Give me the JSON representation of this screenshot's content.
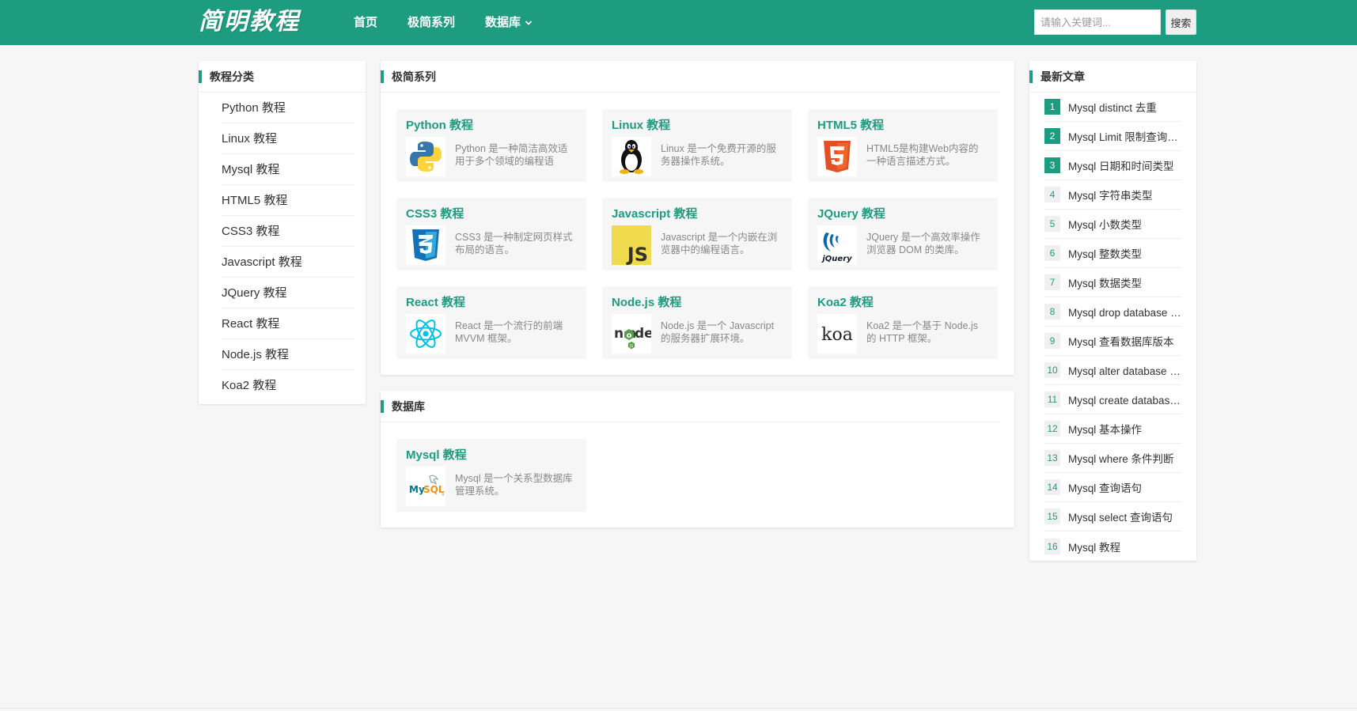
{
  "header": {
    "logo": "简明教程",
    "nav": [
      {
        "label": "首页"
      },
      {
        "label": "极简系列"
      },
      {
        "label": "数据库",
        "has_dropdown": true
      }
    ],
    "search": {
      "placeholder": "请输入关键词...",
      "value": "",
      "button_label": "搜索"
    }
  },
  "sidebar_left": {
    "title": "教程分类",
    "items": [
      {
        "label": "Python 教程"
      },
      {
        "label": "Linux 教程"
      },
      {
        "label": "Mysql 教程"
      },
      {
        "label": "HTML5 教程"
      },
      {
        "label": "CSS3 教程"
      },
      {
        "label": "Javascript 教程"
      },
      {
        "label": "JQuery 教程"
      },
      {
        "label": "React 教程"
      },
      {
        "label": "Node.js 教程"
      },
      {
        "label": "Koa2 教程"
      }
    ]
  },
  "sections": [
    {
      "title": "极简系列",
      "tutorials": [
        {
          "name": "Python 教程",
          "desc": "Python 是一种简洁高效适用于多个领域的编程语",
          "icon": "python-icon"
        },
        {
          "name": "Linux 教程",
          "desc": "Linux 是一个免费开源的服务器操作系统。",
          "icon": "linux-tux-icon"
        },
        {
          "name": "HTML5 教程",
          "desc": "HTML5是构建Web内容的一种语言描述方式。",
          "icon": "html5-icon"
        },
        {
          "name": "CSS3 教程",
          "desc": "CSS3 是一种制定网页样式布局的语言。",
          "icon": "css3-icon"
        },
        {
          "name": "Javascript 教程",
          "desc": "Javascript 是一个内嵌在浏览器中的编程语言。",
          "icon": "javascript-icon"
        },
        {
          "name": "JQuery 教程",
          "desc": "JQuery 是一个高效率操作浏览器 DOM 的类库。",
          "icon": "jquery-icon"
        },
        {
          "name": "React 教程",
          "desc": "React 是一个流行的前端 MVVM 框架。",
          "icon": "react-icon"
        },
        {
          "name": "Node.js 教程",
          "desc": "Node.js 是一个 Javascript 的服务器扩展环境。",
          "icon": "nodejs-icon"
        },
        {
          "name": "Koa2 教程",
          "desc": "Koa2 是一个基于 Node.js 的 HTTP 框架。",
          "icon": "koa-icon"
        }
      ]
    },
    {
      "title": "数据库",
      "tutorials": [
        {
          "name": "Mysql 教程",
          "desc": "Mysql 是一个关系型数据库管理系统。",
          "icon": "mysql-icon"
        }
      ]
    }
  ],
  "sidebar_right": {
    "title": "最新文章",
    "articles": [
      {
        "num": "1",
        "title": "Mysql distinct 去重"
      },
      {
        "num": "2",
        "title": "Mysql Limit 限制查询记录数"
      },
      {
        "num": "3",
        "title": "Mysql 日期和时间类型"
      },
      {
        "num": "4",
        "title": "Mysql 字符串类型"
      },
      {
        "num": "5",
        "title": "Mysql 小数类型"
      },
      {
        "num": "6",
        "title": "Mysql 整数类型"
      },
      {
        "num": "7",
        "title": "Mysql 数据类型"
      },
      {
        "num": "8",
        "title": "Mysql drop database 删除数据库"
      },
      {
        "num": "9",
        "title": "Mysql 查看数据库版本"
      },
      {
        "num": "10",
        "title": "Mysql alter database 修改数据库"
      },
      {
        "num": "11",
        "title": "Mysql create database 创建数据库"
      },
      {
        "num": "12",
        "title": "Mysql 基本操作"
      },
      {
        "num": "13",
        "title": "Mysql where 条件判断"
      },
      {
        "num": "14",
        "title": "Mysql 查询语句"
      },
      {
        "num": "15",
        "title": "Mysql select 查询语句"
      },
      {
        "num": "16",
        "title": "Mysql 教程"
      }
    ],
    "highlight_count": 3
  },
  "colors": {
    "brand": "#1e9c7f",
    "background": "#f6f6f6"
  }
}
